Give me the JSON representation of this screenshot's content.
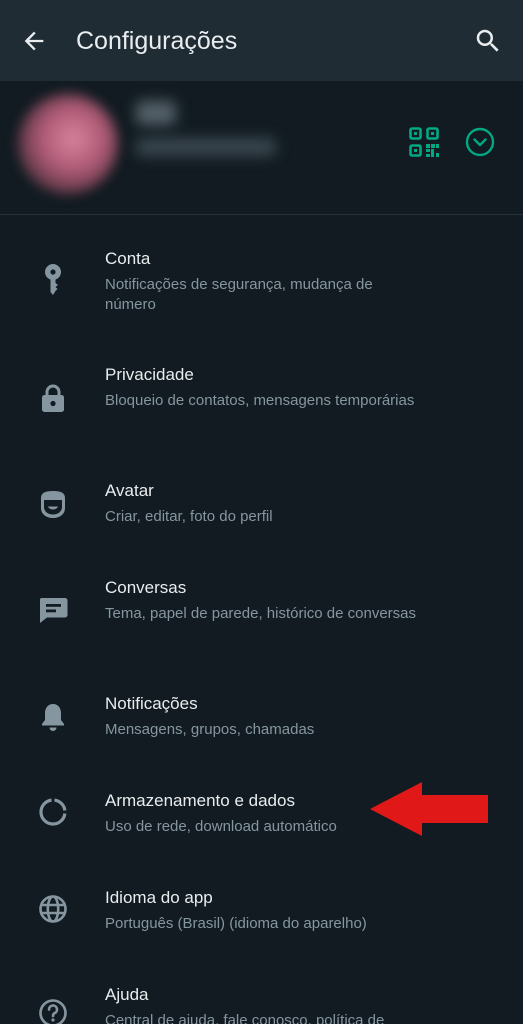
{
  "header": {
    "title": "Configurações"
  },
  "colors": {
    "accent": "#00a884",
    "background": "#111b21",
    "header_bg": "#1f2c34",
    "secondary_text": "#8696a0",
    "annotation_arrow": "#e11818"
  },
  "menu": {
    "items": [
      {
        "icon": "key-icon",
        "label": "Conta",
        "subtitle": "Notificações de segurança, mudança de número"
      },
      {
        "icon": "lock-icon",
        "label": "Privacidade",
        "subtitle": "Bloqueio de contatos, mensagens temporárias"
      },
      {
        "icon": "avatar-face-icon",
        "label": "Avatar",
        "subtitle": "Criar, editar, foto do perfil"
      },
      {
        "icon": "chat-icon",
        "label": "Conversas",
        "subtitle": "Tema, papel de parede, histórico de conversas"
      },
      {
        "icon": "bell-icon",
        "label": "Notificações",
        "subtitle": "Mensagens, grupos, chamadas"
      },
      {
        "icon": "data-usage-icon",
        "label": "Armazenamento e dados",
        "subtitle": "Uso de rede, download automático"
      },
      {
        "icon": "globe-icon",
        "label": "Idioma do app",
        "subtitle": "Português (Brasil) (idioma do aparelho)"
      },
      {
        "icon": "help-icon",
        "label": "Ajuda",
        "subtitle": "Central de ajuda, fale conosco, política de privacidade"
      }
    ]
  }
}
